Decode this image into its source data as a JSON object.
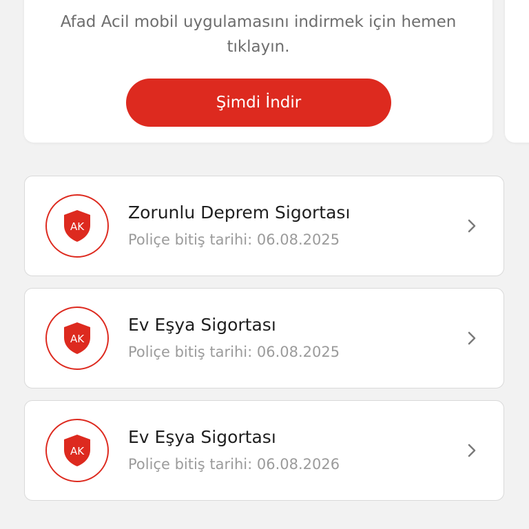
{
  "promo": {
    "text": "Afad Acil mobil uygulamasını indirmek için hemen tıklayın.",
    "button_label": "Şimdi İndir"
  },
  "policies": [
    {
      "logo_text": "AK",
      "title": "Zorunlu Deprem Sigortası",
      "expiry": "Poliçe bitiş tarihi: 06.08.2025"
    },
    {
      "logo_text": "AK",
      "title": "Ev Eşya Sigortası",
      "expiry": "Poliçe bitiş tarihi: 06.08.2025"
    },
    {
      "logo_text": "AK",
      "title": "Ev Eşya Sigortası",
      "expiry": "Poliçe bitiş tarihi: 06.08.2026"
    }
  ],
  "colors": {
    "accent": "#dd2a1f",
    "background": "#f2f2f2",
    "card": "#ffffff",
    "title_text": "#1f1f1f",
    "muted_text": "#9b9b9b"
  },
  "icons": {
    "logo": "ak-shield-icon",
    "row_action": "chevron-right-icon"
  }
}
